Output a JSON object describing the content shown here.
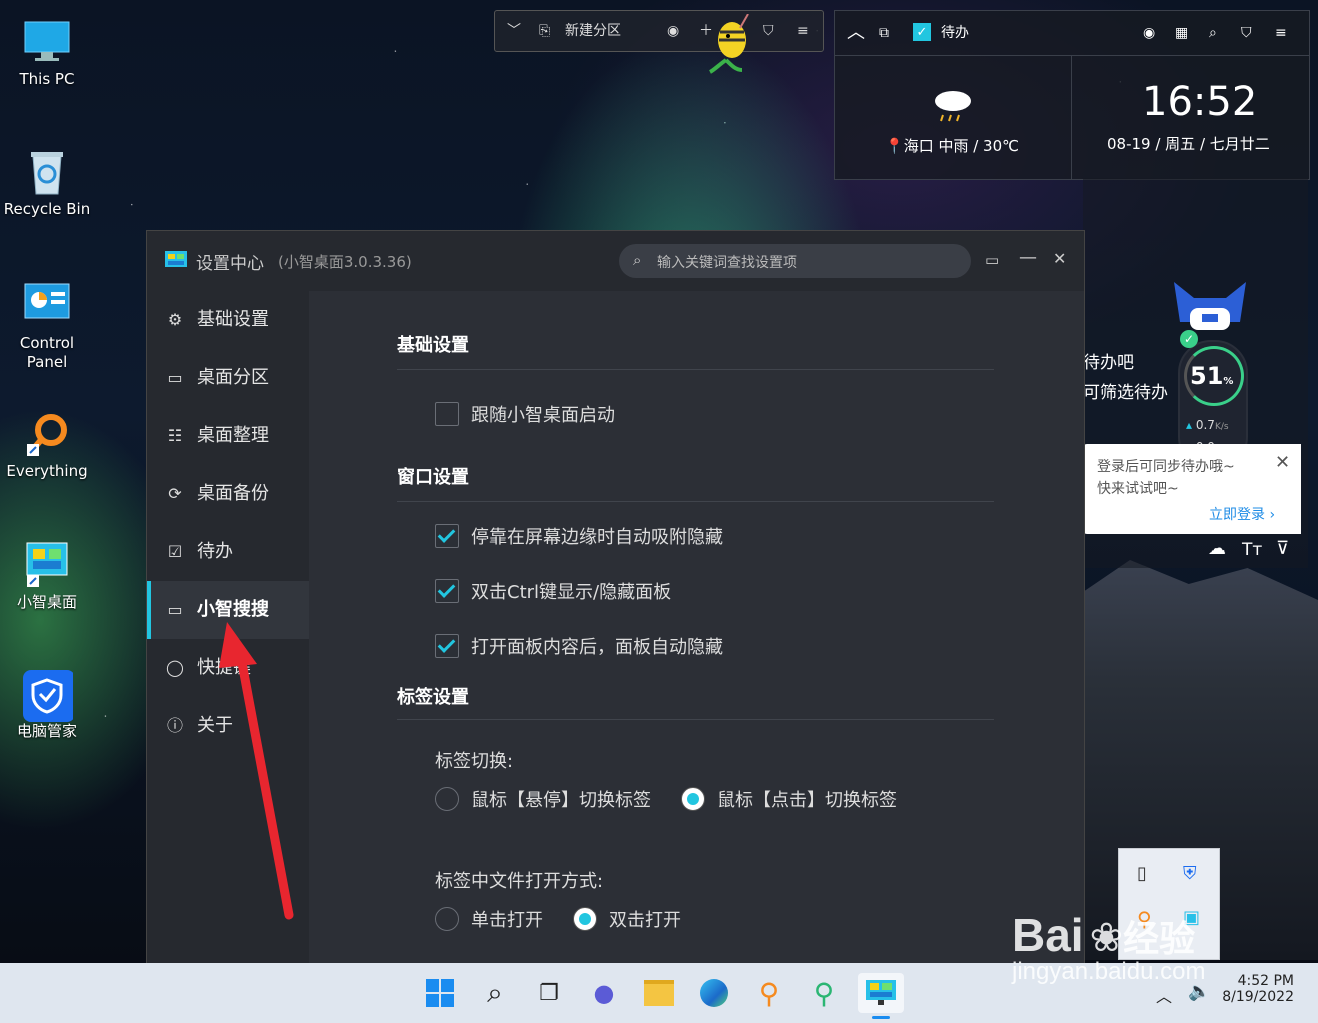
{
  "desktop": {
    "icons": [
      {
        "label": "This PC"
      },
      {
        "label": "Recycle Bin"
      },
      {
        "label": "Control Panel",
        "lines": [
          "Control",
          "Panel"
        ]
      },
      {
        "label": "Everything"
      },
      {
        "label": "小智桌面"
      },
      {
        "label": "电脑管家"
      }
    ]
  },
  "fence_bar": {
    "new_zone_label": "新建分区"
  },
  "widget": {
    "todo_label": "待办",
    "weather": {
      "city": "海口",
      "condition": "中雨",
      "temp": "30℃",
      "text": "海口  中雨 / 30℃"
    },
    "clock": {
      "time": "16:52",
      "date": "08-19 / 周五 / 七月廿二"
    },
    "todo_text_1": "待办吧",
    "todo_text_2": "可筛选待办",
    "speed": {
      "percent": "51",
      "percent_unit": "%",
      "up": "0.7",
      "down": "0.0",
      "unit": "K/s"
    }
  },
  "notice": {
    "line1": "登录后可同步待办哦~",
    "line2": "快来试试吧~",
    "action": "立即登录 ›"
  },
  "settings_window": {
    "title": "设置中心",
    "version": "(小智桌面3.0.3.36)",
    "search_placeholder": "输入关键词查找设置项",
    "nav": [
      {
        "label": "基础设置",
        "icon": "gear-icon"
      },
      {
        "label": "桌面分区",
        "icon": "monitor-icon"
      },
      {
        "label": "桌面整理",
        "icon": "list-icon"
      },
      {
        "label": "桌面备份",
        "icon": "sync-icon"
      },
      {
        "label": "待办",
        "icon": "calendar-check-icon"
      },
      {
        "label": "小智搜搜",
        "icon": "window-icon",
        "active": true
      },
      {
        "label": "快捷键",
        "icon": "mouse-icon"
      },
      {
        "label": "关于",
        "icon": "info-icon"
      }
    ],
    "sections": {
      "basic": {
        "title": "基础设置",
        "options": [
          {
            "label": "跟随小智桌面启动",
            "checked": false
          }
        ]
      },
      "window": {
        "title": "窗口设置",
        "options": [
          {
            "label": "停靠在屏幕边缘时自动吸附隐藏",
            "checked": true
          },
          {
            "label": "双击Ctrl键显示/隐藏面板",
            "checked": true
          },
          {
            "label": "打开面板内容后，面板自动隐藏",
            "checked": true
          }
        ]
      },
      "tabs": {
        "title": "标签设置",
        "switch_label": "标签切换:",
        "switch_options": [
          {
            "label": "鼠标【悬停】切换标签",
            "selected": false
          },
          {
            "label": "鼠标【点击】切换标签",
            "selected": true
          }
        ],
        "open_label": "标签中文件打开方式:",
        "open_options": [
          {
            "label": "单击打开",
            "selected": false
          },
          {
            "label": "双击打开",
            "selected": true
          }
        ]
      }
    }
  },
  "taskbar": {
    "time": "4:52 PM",
    "date": "8/19/2022"
  },
  "watermark": {
    "brand": "Bai",
    "brand2": "经验",
    "url": "jingyan.baidu.com"
  },
  "colors": {
    "accent": "#22c6e0",
    "arrow": "#e8262f"
  }
}
